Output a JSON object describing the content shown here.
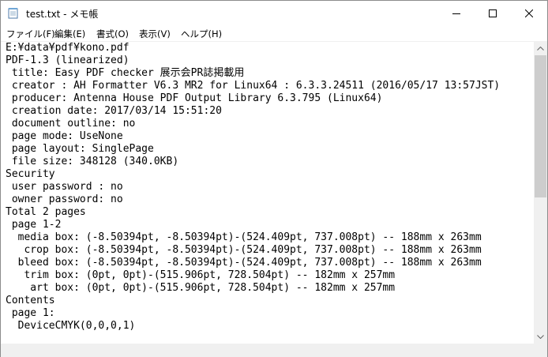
{
  "window": {
    "title": "test.txt - メモ帳"
  },
  "menu": [
    {
      "id": "file",
      "label": "ファイル(F)"
    },
    {
      "id": "edit",
      "label": "編集(E)"
    },
    {
      "id": "format",
      "label": "書式(O)"
    },
    {
      "id": "view",
      "label": "表示(V)"
    },
    {
      "id": "help",
      "label": "ヘルプ(H)"
    }
  ],
  "lines": [
    "E:¥data¥pdf¥kono.pdf",
    "PDF-1.3 (linearized)",
    " title: Easy PDF checker 展示会PR誌掲載用",
    " creator : AH Formatter V6.3 MR2 for Linux64 : 6.3.3.24511 (2016/05/17 13:57JST)",
    " producer: Antenna House PDF Output Library 6.3.795 (Linux64)",
    " creation date: 2017/03/14 15:51:20",
    " document outline: no",
    " page mode: UseNone",
    " page layout: SinglePage",
    " file size: 348128 (340.0KB)",
    "Security",
    " user password : no",
    " owner password: no",
    "Total 2 pages",
    " page 1-2",
    "  media box: (-8.50394pt, -8.50394pt)-(524.409pt, 737.008pt) -- 188mm x 263mm",
    "   crop box: (-8.50394pt, -8.50394pt)-(524.409pt, 737.008pt) -- 188mm x 263mm",
    "  bleed box: (-8.50394pt, -8.50394pt)-(524.409pt, 737.008pt) -- 188mm x 263mm",
    "   trim box: (0pt, 0pt)-(515.906pt, 728.504pt) -- 182mm x 257mm",
    "    art box: (0pt, 0pt)-(515.906pt, 728.504pt) -- 182mm x 257mm",
    "Contents",
    " page 1:",
    "  DeviceCMYK(0,0,0,1)"
  ]
}
